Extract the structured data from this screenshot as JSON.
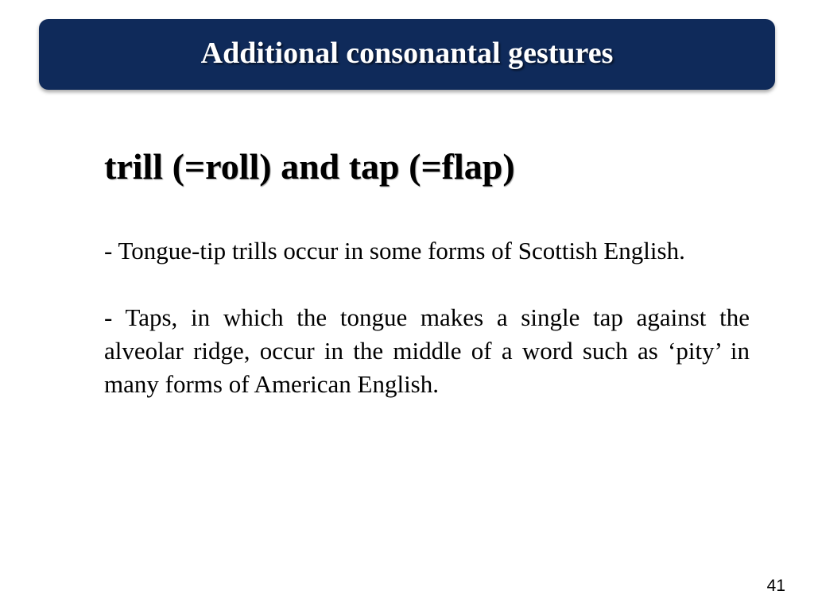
{
  "slide": {
    "title": "Additional consonantal gestures",
    "heading": "trill (=roll) and tap (=flap)",
    "paragraphs": [
      "- Tongue-tip trills occur in some forms of Scottish English.",
      "- Taps, in which the tongue makes a single tap against the alveolar ridge, occur in the middle of a word such as ‘pity’ in many forms of American English."
    ],
    "page_number": "41"
  },
  "colors": {
    "title_banner": "#0f2a5a",
    "title_text": "#ffffff",
    "body_text": "#000000",
    "background": "#ffffff"
  }
}
